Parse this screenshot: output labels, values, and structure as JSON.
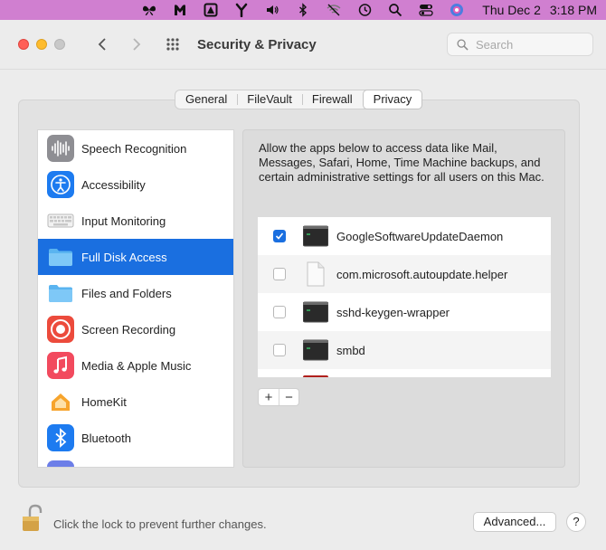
{
  "menubar": {
    "icons": [
      "butterfly-icon",
      "malwarebytes-icon",
      "vpn-icon",
      "fork-icon",
      "volume-icon",
      "bluetooth-icon",
      "wifi-off-icon",
      "time-machine-icon",
      "spotlight-search-icon",
      "control-center-icon",
      "siri-icon"
    ],
    "date": "Thu Dec 2",
    "time": "3:18 PM"
  },
  "window": {
    "title": "Security & Privacy",
    "search_placeholder": "Search"
  },
  "tabs": [
    {
      "label": "General",
      "active": false
    },
    {
      "label": "FileVault",
      "active": false
    },
    {
      "label": "Firewall",
      "active": false
    },
    {
      "label": "Privacy",
      "active": true
    }
  ],
  "sidebar": {
    "items": [
      {
        "label": "Speech Recognition",
        "icon": "speech-recognition-icon",
        "selected": false
      },
      {
        "label": "Accessibility",
        "icon": "accessibility-icon",
        "selected": false
      },
      {
        "label": "Input Monitoring",
        "icon": "keyboard-icon",
        "selected": false
      },
      {
        "label": "Full Disk Access",
        "icon": "folder-icon",
        "selected": true
      },
      {
        "label": "Files and Folders",
        "icon": "folder-icon",
        "selected": false
      },
      {
        "label": "Screen Recording",
        "icon": "screen-recording-icon",
        "selected": false
      },
      {
        "label": "Media & Apple Music",
        "icon": "music-icon",
        "selected": false
      },
      {
        "label": "HomeKit",
        "icon": "home-icon",
        "selected": false
      },
      {
        "label": "Bluetooth",
        "icon": "bluetooth-icon",
        "selected": false
      }
    ]
  },
  "detail": {
    "description": "Allow the apps below to access data like Mail, Messages, Safari, Home, Time Machine backups, and certain administrative settings for all users on this Mac.",
    "apps": [
      {
        "name": "GoogleSoftwareUpdateDaemon",
        "checked": true,
        "icon": "terminal-icon"
      },
      {
        "name": "com.microsoft.autoupdate.helper",
        "checked": false,
        "icon": "document-icon"
      },
      {
        "name": "sshd-keygen-wrapper",
        "checked": false,
        "icon": "terminal-icon"
      },
      {
        "name": "smbd",
        "checked": false,
        "icon": "terminal-icon"
      }
    ],
    "add_label": "+",
    "remove_label": "−"
  },
  "footer": {
    "lock_text": "Click the lock to prevent further changes.",
    "advanced_label": "Advanced...",
    "help_label": "?"
  },
  "colors": {
    "accent": "#1a6fe0",
    "menubar": "#d07fd0",
    "window_bg": "#ececec"
  }
}
